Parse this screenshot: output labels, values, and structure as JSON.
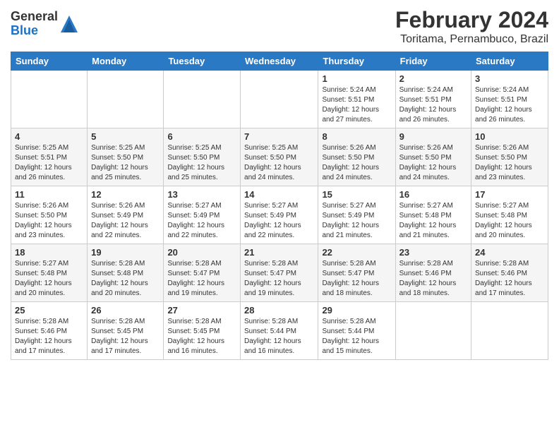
{
  "header": {
    "logo_general": "General",
    "logo_blue": "Blue",
    "title": "February 2024",
    "subtitle": "Toritama, Pernambuco, Brazil"
  },
  "weekdays": [
    "Sunday",
    "Monday",
    "Tuesday",
    "Wednesday",
    "Thursday",
    "Friday",
    "Saturday"
  ],
  "weeks": [
    [
      {
        "day": "",
        "detail": ""
      },
      {
        "day": "",
        "detail": ""
      },
      {
        "day": "",
        "detail": ""
      },
      {
        "day": "",
        "detail": ""
      },
      {
        "day": "1",
        "detail": "Sunrise: 5:24 AM\nSunset: 5:51 PM\nDaylight: 12 hours\nand 27 minutes."
      },
      {
        "day": "2",
        "detail": "Sunrise: 5:24 AM\nSunset: 5:51 PM\nDaylight: 12 hours\nand 26 minutes."
      },
      {
        "day": "3",
        "detail": "Sunrise: 5:24 AM\nSunset: 5:51 PM\nDaylight: 12 hours\nand 26 minutes."
      }
    ],
    [
      {
        "day": "4",
        "detail": "Sunrise: 5:25 AM\nSunset: 5:51 PM\nDaylight: 12 hours\nand 26 minutes."
      },
      {
        "day": "5",
        "detail": "Sunrise: 5:25 AM\nSunset: 5:50 PM\nDaylight: 12 hours\nand 25 minutes."
      },
      {
        "day": "6",
        "detail": "Sunrise: 5:25 AM\nSunset: 5:50 PM\nDaylight: 12 hours\nand 25 minutes."
      },
      {
        "day": "7",
        "detail": "Sunrise: 5:25 AM\nSunset: 5:50 PM\nDaylight: 12 hours\nand 24 minutes."
      },
      {
        "day": "8",
        "detail": "Sunrise: 5:26 AM\nSunset: 5:50 PM\nDaylight: 12 hours\nand 24 minutes."
      },
      {
        "day": "9",
        "detail": "Sunrise: 5:26 AM\nSunset: 5:50 PM\nDaylight: 12 hours\nand 24 minutes."
      },
      {
        "day": "10",
        "detail": "Sunrise: 5:26 AM\nSunset: 5:50 PM\nDaylight: 12 hours\nand 23 minutes."
      }
    ],
    [
      {
        "day": "11",
        "detail": "Sunrise: 5:26 AM\nSunset: 5:50 PM\nDaylight: 12 hours\nand 23 minutes."
      },
      {
        "day": "12",
        "detail": "Sunrise: 5:26 AM\nSunset: 5:49 PM\nDaylight: 12 hours\nand 22 minutes."
      },
      {
        "day": "13",
        "detail": "Sunrise: 5:27 AM\nSunset: 5:49 PM\nDaylight: 12 hours\nand 22 minutes."
      },
      {
        "day": "14",
        "detail": "Sunrise: 5:27 AM\nSunset: 5:49 PM\nDaylight: 12 hours\nand 22 minutes."
      },
      {
        "day": "15",
        "detail": "Sunrise: 5:27 AM\nSunset: 5:49 PM\nDaylight: 12 hours\nand 21 minutes."
      },
      {
        "day": "16",
        "detail": "Sunrise: 5:27 AM\nSunset: 5:48 PM\nDaylight: 12 hours\nand 21 minutes."
      },
      {
        "day": "17",
        "detail": "Sunrise: 5:27 AM\nSunset: 5:48 PM\nDaylight: 12 hours\nand 20 minutes."
      }
    ],
    [
      {
        "day": "18",
        "detail": "Sunrise: 5:27 AM\nSunset: 5:48 PM\nDaylight: 12 hours\nand 20 minutes."
      },
      {
        "day": "19",
        "detail": "Sunrise: 5:28 AM\nSunset: 5:48 PM\nDaylight: 12 hours\nand 20 minutes."
      },
      {
        "day": "20",
        "detail": "Sunrise: 5:28 AM\nSunset: 5:47 PM\nDaylight: 12 hours\nand 19 minutes."
      },
      {
        "day": "21",
        "detail": "Sunrise: 5:28 AM\nSunset: 5:47 PM\nDaylight: 12 hours\nand 19 minutes."
      },
      {
        "day": "22",
        "detail": "Sunrise: 5:28 AM\nSunset: 5:47 PM\nDaylight: 12 hours\nand 18 minutes."
      },
      {
        "day": "23",
        "detail": "Sunrise: 5:28 AM\nSunset: 5:46 PM\nDaylight: 12 hours\nand 18 minutes."
      },
      {
        "day": "24",
        "detail": "Sunrise: 5:28 AM\nSunset: 5:46 PM\nDaylight: 12 hours\nand 17 minutes."
      }
    ],
    [
      {
        "day": "25",
        "detail": "Sunrise: 5:28 AM\nSunset: 5:46 PM\nDaylight: 12 hours\nand 17 minutes."
      },
      {
        "day": "26",
        "detail": "Sunrise: 5:28 AM\nSunset: 5:45 PM\nDaylight: 12 hours\nand 17 minutes."
      },
      {
        "day": "27",
        "detail": "Sunrise: 5:28 AM\nSunset: 5:45 PM\nDaylight: 12 hours\nand 16 minutes."
      },
      {
        "day": "28",
        "detail": "Sunrise: 5:28 AM\nSunset: 5:44 PM\nDaylight: 12 hours\nand 16 minutes."
      },
      {
        "day": "29",
        "detail": "Sunrise: 5:28 AM\nSunset: 5:44 PM\nDaylight: 12 hours\nand 15 minutes."
      },
      {
        "day": "",
        "detail": ""
      },
      {
        "day": "",
        "detail": ""
      }
    ]
  ]
}
